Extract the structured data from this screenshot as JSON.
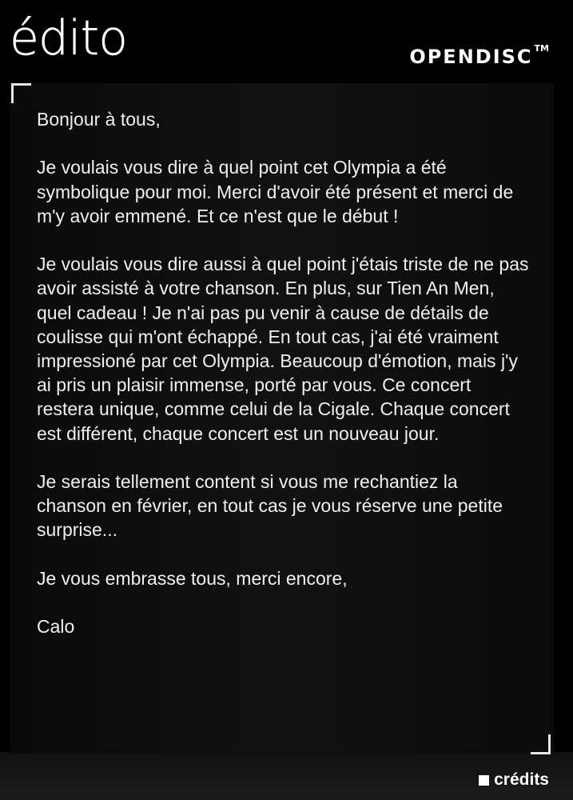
{
  "header": {
    "title": "édito",
    "brand": "OPENDISC",
    "brand_tm": "TM"
  },
  "letter": {
    "paragraphs": [
      "Bonjour à tous,",
      "Je voulais vous dire à quel point cet Olympia a été symbolique pour moi. Merci d'avoir été présent et merci de m'y avoir emmené. Et ce n'est que le début !",
      "Je voulais vous dire aussi à quel point j'étais triste de ne pas avoir assisté à votre chanson. En plus, sur Tien An Men, quel cadeau ! Je n'ai pas pu venir à cause de détails de coulisse qui m'ont échappé. En tout cas, j'ai été vraiment impressioné par cet Olympia. Beaucoup d'émotion, mais j'y ai pris un plaisir immense, porté par vous. Ce concert restera unique, comme celui de la Cigale. Chaque concert est différent, chaque concert est un nouveau jour.",
      "Je serais tellement content si vous me rechantiez la chanson en février, en tout cas je vous réserve une petite surprise...",
      "Je vous embrasse tous, merci encore,",
      "Calo"
    ]
  },
  "footer": {
    "credits_label": "crédits",
    "credits_icon": "square-bullet-icon"
  },
  "colors": {
    "background": "#000000",
    "text": "#f0f0f0",
    "accent": "#ffffff"
  }
}
